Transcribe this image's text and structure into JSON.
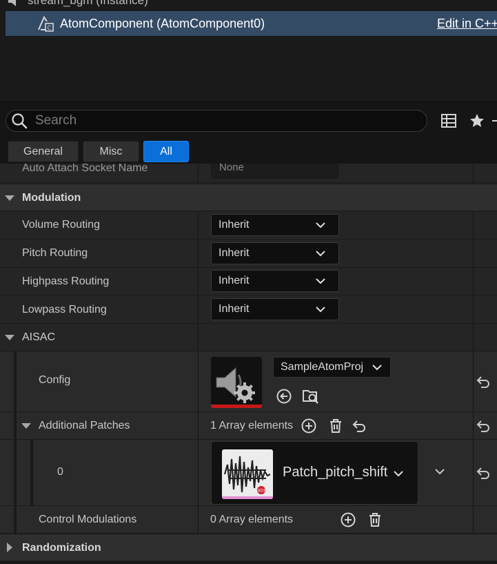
{
  "component_tree": {
    "parent_label": "stream_bgm (Instance)",
    "selected_label": "AtomComponent (AtomComponent0)",
    "edit_link": "Edit in C++"
  },
  "search": {
    "placeholder": "Search"
  },
  "filters": [
    {
      "label": "General",
      "active": false
    },
    {
      "label": "Misc",
      "active": false
    },
    {
      "label": "All",
      "active": true
    }
  ],
  "partial_row": {
    "label": "Auto Attach Socket Name",
    "value": "None"
  },
  "modulation": {
    "title": "Modulation",
    "rows": [
      {
        "label": "Volume Routing",
        "value": "Inherit"
      },
      {
        "label": "Pitch Routing",
        "value": "Inherit"
      },
      {
        "label": "Highpass Routing",
        "value": "Inherit"
      },
      {
        "label": "Lowpass Routing",
        "value": "Inherit"
      }
    ]
  },
  "aisac": {
    "title": "AISAC",
    "config_label": "Config",
    "config_asset": "SampleAtomProj",
    "patches_label": "Additional Patches",
    "patches_count": "1 Array elements",
    "patch_index": "0",
    "patch_asset": "Patch_pitch_shift",
    "patch_badge": "ADX",
    "control_label": "Control Modulations",
    "control_count": "0 Array elements"
  },
  "randomization": {
    "title": "Randomization"
  },
  "colors": {
    "selection": "#344b66",
    "active_tab": "#0a6fd8",
    "asset_underline_config": "#c81818",
    "asset_underline_patch": "#e58fd6"
  }
}
